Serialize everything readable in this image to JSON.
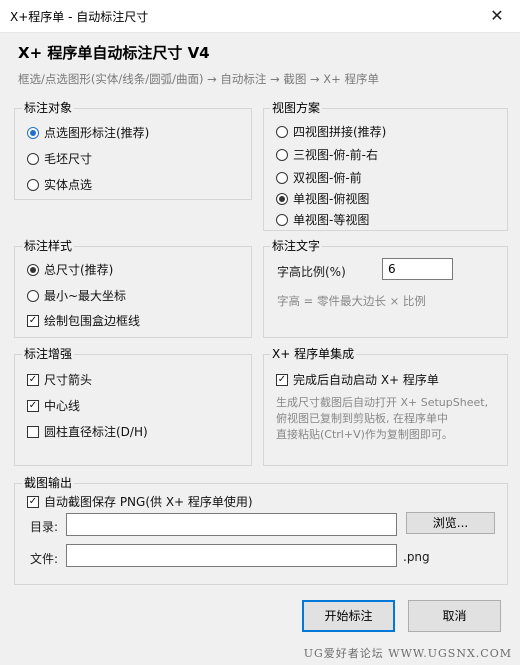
{
  "window": {
    "title": "X+程序单 - 自动标注尺寸",
    "close_glyph": "✕"
  },
  "header": {
    "title": "X+ 程序单自动标注尺寸  V4",
    "subtitle": "框选/点选图形(实体/线条/圆弧/曲面) → 自动标注 → 截图 → X+ 程序单"
  },
  "target_group": {
    "legend": "标注对象",
    "options": [
      {
        "label": "点选图形标注(推荐)",
        "selected": true
      },
      {
        "label": "毛坯尺寸",
        "selected": false
      },
      {
        "label": "实体点选",
        "selected": false
      }
    ]
  },
  "view_group": {
    "legend": "视图方案",
    "options": [
      {
        "label": "四视图拼接(推荐)",
        "selected": false
      },
      {
        "label": "三视图-俯-前-右",
        "selected": false
      },
      {
        "label": "双视图-俯-前",
        "selected": false
      },
      {
        "label": "单视图-俯视图",
        "selected": true
      },
      {
        "label": "单视图-等视图",
        "selected": false
      }
    ]
  },
  "style_group": {
    "legend": "标注样式",
    "radios": [
      {
        "label": "总尺寸(推荐)",
        "selected": true
      },
      {
        "label": "最小~最大坐标",
        "selected": false
      }
    ],
    "checkbox": {
      "label": "绘制包围盒边框线",
      "checked": true
    }
  },
  "text_group": {
    "legend": "标注文字",
    "height_label": "字高比例(%)",
    "height_value": "6",
    "formula": "字高 = 零件最大边长 × 比例"
  },
  "enhance_group": {
    "legend": "标注增强",
    "checks": [
      {
        "label": "尺寸箭头",
        "checked": true
      },
      {
        "label": "中心线",
        "checked": true
      },
      {
        "label": "圆柱直径标注(D/H)",
        "checked": false
      }
    ]
  },
  "integration_group": {
    "legend": "X+ 程序单集成",
    "check": {
      "label": "完成后自动启动 X+ 程序单",
      "checked": true
    },
    "note_lines": [
      "生成尺寸截图后自动打开 X+ SetupSheet,",
      "俯视图已复制到剪贴板, 在程序单中",
      "直接粘贴(Ctrl+V)作为复制图即可。"
    ]
  },
  "output_group": {
    "legend": "截图输出",
    "check": {
      "label": "自动截图保存 PNG(供 X+ 程序单使用)",
      "checked": true
    },
    "dir_label": "目录:",
    "dir_value": "",
    "browse_label": "浏览...",
    "file_label": "文件:",
    "file_value": "",
    "ext": ".png"
  },
  "buttons": {
    "start": "开始标注",
    "cancel": "取消"
  },
  "watermark": "UG爱好者论坛 WWW.UGSNX.COM"
}
